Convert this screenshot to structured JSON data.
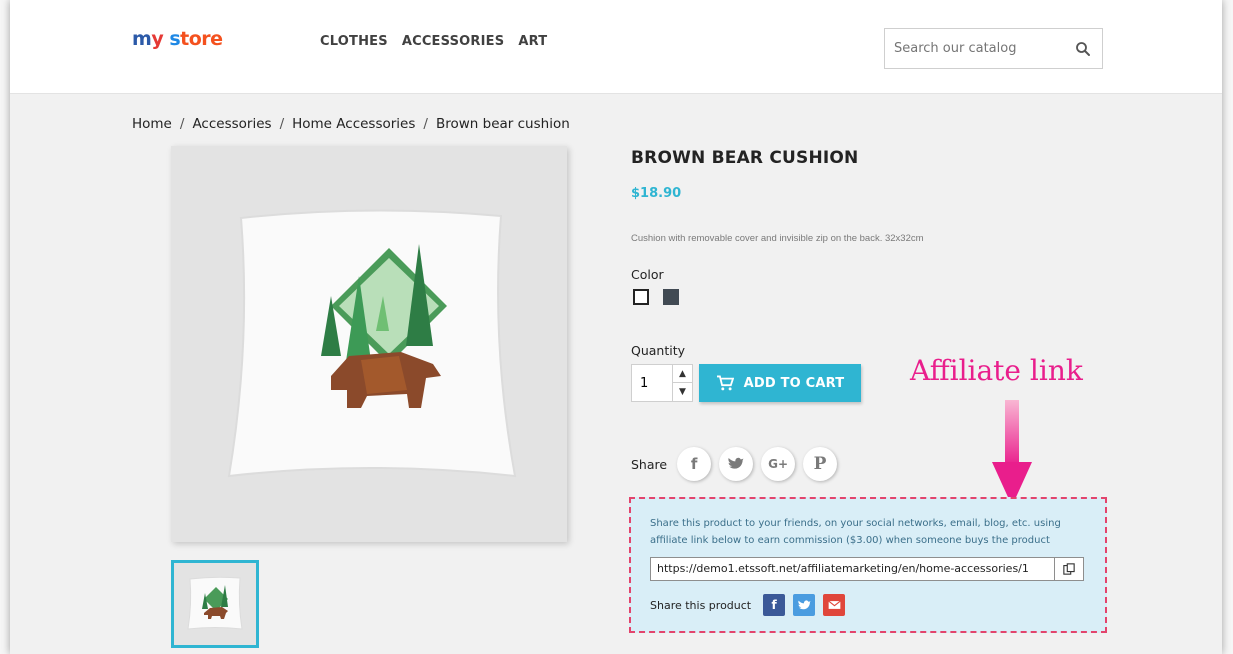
{
  "header": {
    "logo": [
      "m",
      "y ",
      "s",
      "tore"
    ],
    "nav": [
      "CLOTHES",
      "ACCESSORIES",
      "ART"
    ],
    "search_placeholder": "Search our catalog"
  },
  "breadcrumb": [
    "Home",
    "Accessories",
    "Home Accessories",
    "Brown bear cushion"
  ],
  "product": {
    "title": "BROWN BEAR CUSHION",
    "price": "$18.90",
    "description": "Cushion with removable cover and invisible zip on the back. 32x32cm",
    "color_label": "Color",
    "quantity_label": "Quantity",
    "quantity_value": "1",
    "add_to_cart": "ADD TO CART",
    "share_label": "Share",
    "share_networks": [
      "f",
      "t",
      "G+",
      "P"
    ]
  },
  "affiliate": {
    "annotation": "Affiliate link",
    "text": "Share this product to your friends, on your social networks, email, blog, etc. using affiliate link below to earn commission ($3.00) when someone buys the product",
    "link": "https://demo1.etssoft.net/affiliatemarketing/en/home-accessories/1",
    "share_label": "Share this product"
  },
  "colors": {
    "accent": "#2fb5d2",
    "annotation": "#e91e8c",
    "box_bg": "#d9eef7",
    "box_border": "#e3446c"
  }
}
